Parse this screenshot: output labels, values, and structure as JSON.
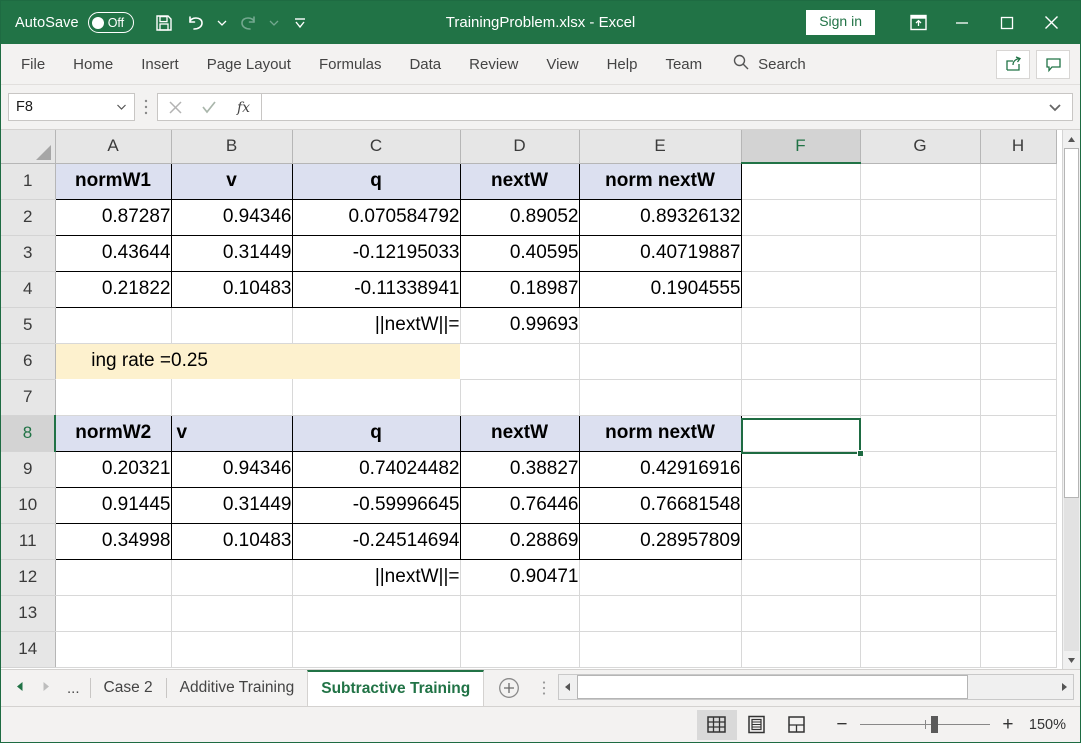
{
  "titlebar": {
    "autosave_label": "AutoSave",
    "autosave_state": "Off",
    "document_title": "TrainingProblem.xlsx  -  Excel",
    "sign_in": "Sign in",
    "icons": {
      "save": "save-icon",
      "undo": "undo-icon",
      "redo": "redo-icon",
      "customize": "customize-qat-icon",
      "ribbon_display": "ribbon-display-options-icon",
      "minimize": "minimize-icon",
      "maximize": "maximize-icon",
      "close": "close-icon"
    }
  },
  "ribbon": {
    "tabs": [
      {
        "label": "File"
      },
      {
        "label": "Home"
      },
      {
        "label": "Insert"
      },
      {
        "label": "Page Layout"
      },
      {
        "label": "Formulas"
      },
      {
        "label": "Data"
      },
      {
        "label": "Review"
      },
      {
        "label": "View"
      },
      {
        "label": "Help"
      },
      {
        "label": "Team"
      }
    ],
    "search_placeholder": "Search",
    "share_label": "Share",
    "comments_label": "Comments"
  },
  "formula_bar": {
    "name_box_value": "F8",
    "formula_value": "",
    "cancel_label": "Cancel",
    "enter_label": "Enter",
    "fx_label": "fx"
  },
  "grid": {
    "columns": [
      "A",
      "B",
      "C",
      "D",
      "E",
      "F",
      "G",
      "H"
    ],
    "active_column": "F",
    "active_row": 8,
    "selected_cell": "F8",
    "rows": [
      {
        "number": 1,
        "cells": [
          {
            "col": "A",
            "value": "normW1",
            "style": "hdr"
          },
          {
            "col": "B",
            "value": "v",
            "style": "hdr"
          },
          {
            "col": "C",
            "value": "q",
            "style": "hdr"
          },
          {
            "col": "D",
            "value": "nextW",
            "style": "hdr"
          },
          {
            "col": "E",
            "value": "norm nextW",
            "style": "hdr"
          },
          {
            "col": "F",
            "value": "",
            "style": "blank"
          },
          {
            "col": "G",
            "value": "",
            "style": "blank"
          },
          {
            "col": "H",
            "value": "",
            "style": "blank"
          }
        ]
      },
      {
        "number": 2,
        "cells": [
          {
            "col": "A",
            "value": "0.87287",
            "style": "blk-num"
          },
          {
            "col": "B",
            "value": "0.94346",
            "style": "blk-num"
          },
          {
            "col": "C",
            "value": "0.070584792",
            "style": "blk-num"
          },
          {
            "col": "D",
            "value": "0.89052",
            "style": "blk-num"
          },
          {
            "col": "E",
            "value": "0.89326132",
            "style": "blk-num"
          },
          {
            "col": "F",
            "value": "",
            "style": "blank"
          },
          {
            "col": "G",
            "value": "",
            "style": "blank"
          },
          {
            "col": "H",
            "value": "",
            "style": "blank"
          }
        ]
      },
      {
        "number": 3,
        "cells": [
          {
            "col": "A",
            "value": "0.43644",
            "style": "blk-num"
          },
          {
            "col": "B",
            "value": "0.31449",
            "style": "blk-num"
          },
          {
            "col": "C",
            "value": "-0.12195033",
            "style": "blk-num"
          },
          {
            "col": "D",
            "value": "0.40595",
            "style": "blk-num"
          },
          {
            "col": "E",
            "value": "0.40719887",
            "style": "blk-num"
          },
          {
            "col": "F",
            "value": "",
            "style": "blank"
          },
          {
            "col": "G",
            "value": "",
            "style": "blank"
          },
          {
            "col": "H",
            "value": "",
            "style": "blank"
          }
        ]
      },
      {
        "number": 4,
        "cells": [
          {
            "col": "A",
            "value": "0.21822",
            "style": "blk-num"
          },
          {
            "col": "B",
            "value": "0.10483",
            "style": "blk-num"
          },
          {
            "col": "C",
            "value": "-0.11338941",
            "style": "blk-num"
          },
          {
            "col": "D",
            "value": "0.18987",
            "style": "blk-num"
          },
          {
            "col": "E",
            "value": "0.1904555",
            "style": "blk-num"
          },
          {
            "col": "F",
            "value": "",
            "style": "blank"
          },
          {
            "col": "G",
            "value": "",
            "style": "blank"
          },
          {
            "col": "H",
            "value": "",
            "style": "blank"
          }
        ]
      },
      {
        "number": 5,
        "cells": [
          {
            "col": "A",
            "value": "",
            "style": "blank"
          },
          {
            "col": "B",
            "value": "",
            "style": "blank"
          },
          {
            "col": "C",
            "value": "||nextW||=",
            "style": "num"
          },
          {
            "col": "D",
            "value": "0.99693",
            "style": "num"
          },
          {
            "col": "E",
            "value": "",
            "style": "blank"
          },
          {
            "col": "F",
            "value": "",
            "style": "blank"
          },
          {
            "col": "G",
            "value": "",
            "style": "blank"
          },
          {
            "col": "H",
            "value": "",
            "style": "blank"
          }
        ]
      },
      {
        "number": 6,
        "cells": [
          {
            "col": "A",
            "value": "ing rate =",
            "style": "orange-num"
          },
          {
            "col": "B",
            "value": "0.25",
            "style": "orange-left"
          },
          {
            "col": "C",
            "value": "",
            "style": "orange-blank"
          },
          {
            "col": "D",
            "value": "",
            "style": "blank"
          },
          {
            "col": "E",
            "value": "",
            "style": "blank"
          },
          {
            "col": "F",
            "value": "",
            "style": "blank"
          },
          {
            "col": "G",
            "value": "",
            "style": "blank"
          },
          {
            "col": "H",
            "value": "",
            "style": "blank"
          }
        ]
      },
      {
        "number": 7,
        "cells": [
          {
            "col": "A",
            "value": "",
            "style": "blank"
          },
          {
            "col": "B",
            "value": "",
            "style": "blank"
          },
          {
            "col": "C",
            "value": "",
            "style": "blank"
          },
          {
            "col": "D",
            "value": "",
            "style": "blank"
          },
          {
            "col": "E",
            "value": "",
            "style": "blank"
          },
          {
            "col": "F",
            "value": "",
            "style": "blank"
          },
          {
            "col": "G",
            "value": "",
            "style": "blank"
          },
          {
            "col": "H",
            "value": "",
            "style": "blank"
          }
        ]
      },
      {
        "number": 8,
        "cells": [
          {
            "col": "A",
            "value": "normW2",
            "style": "hdr"
          },
          {
            "col": "B",
            "value": "v",
            "style": "hdr-left"
          },
          {
            "col": "C",
            "value": "q",
            "style": "hdr"
          },
          {
            "col": "D",
            "value": "nextW",
            "style": "hdr"
          },
          {
            "col": "E",
            "value": "norm nextW",
            "style": "hdr"
          },
          {
            "col": "F",
            "value": "",
            "style": "blank"
          },
          {
            "col": "G",
            "value": "",
            "style": "blank"
          },
          {
            "col": "H",
            "value": "",
            "style": "blank"
          }
        ]
      },
      {
        "number": 9,
        "cells": [
          {
            "col": "A",
            "value": "0.20321",
            "style": "blk-num"
          },
          {
            "col": "B",
            "value": "0.94346",
            "style": "blk-num"
          },
          {
            "col": "C",
            "value": "0.74024482",
            "style": "blk-num"
          },
          {
            "col": "D",
            "value": "0.38827",
            "style": "blk-num"
          },
          {
            "col": "E",
            "value": "0.42916916",
            "style": "blk-num"
          },
          {
            "col": "F",
            "value": "",
            "style": "blank"
          },
          {
            "col": "G",
            "value": "",
            "style": "blank"
          },
          {
            "col": "H",
            "value": "",
            "style": "blank"
          }
        ]
      },
      {
        "number": 10,
        "cells": [
          {
            "col": "A",
            "value": "0.91445",
            "style": "blk-num"
          },
          {
            "col": "B",
            "value": "0.31449",
            "style": "blk-num"
          },
          {
            "col": "C",
            "value": "-0.59996645",
            "style": "blk-num"
          },
          {
            "col": "D",
            "value": "0.76446",
            "style": "blk-num"
          },
          {
            "col": "E",
            "value": "0.76681548",
            "style": "blk-num"
          },
          {
            "col": "F",
            "value": "",
            "style": "blank"
          },
          {
            "col": "G",
            "value": "",
            "style": "blank"
          },
          {
            "col": "H",
            "value": "",
            "style": "blank"
          }
        ]
      },
      {
        "number": 11,
        "cells": [
          {
            "col": "A",
            "value": "0.34998",
            "style": "blk-num"
          },
          {
            "col": "B",
            "value": "0.10483",
            "style": "blk-num"
          },
          {
            "col": "C",
            "value": "-0.24514694",
            "style": "blk-num"
          },
          {
            "col": "D",
            "value": "0.28869",
            "style": "blk-num"
          },
          {
            "col": "E",
            "value": "0.28957809",
            "style": "blk-num"
          },
          {
            "col": "F",
            "value": "",
            "style": "blank"
          },
          {
            "col": "G",
            "value": "",
            "style": "blank"
          },
          {
            "col": "H",
            "value": "",
            "style": "blank"
          }
        ]
      },
      {
        "number": 12,
        "cells": [
          {
            "col": "A",
            "value": "",
            "style": "blank"
          },
          {
            "col": "B",
            "value": "",
            "style": "blank"
          },
          {
            "col": "C",
            "value": "||nextW||=",
            "style": "num"
          },
          {
            "col": "D",
            "value": "0.90471",
            "style": "num"
          },
          {
            "col": "E",
            "value": "",
            "style": "blank"
          },
          {
            "col": "F",
            "value": "",
            "style": "blank"
          },
          {
            "col": "G",
            "value": "",
            "style": "blank"
          },
          {
            "col": "H",
            "value": "",
            "style": "blank"
          }
        ]
      },
      {
        "number": 13,
        "cells": [
          {
            "col": "A",
            "value": "",
            "style": "blank"
          },
          {
            "col": "B",
            "value": "",
            "style": "blank"
          },
          {
            "col": "C",
            "value": "",
            "style": "blank"
          },
          {
            "col": "D",
            "value": "",
            "style": "blank"
          },
          {
            "col": "E",
            "value": "",
            "style": "blank"
          },
          {
            "col": "F",
            "value": "",
            "style": "blank"
          },
          {
            "col": "G",
            "value": "",
            "style": "blank"
          },
          {
            "col": "H",
            "value": "",
            "style": "blank"
          }
        ]
      },
      {
        "number": 14,
        "cells": [
          {
            "col": "A",
            "value": "",
            "style": "blank"
          },
          {
            "col": "B",
            "value": "",
            "style": "blank"
          },
          {
            "col": "C",
            "value": "",
            "style": "blank"
          },
          {
            "col": "D",
            "value": "",
            "style": "blank"
          },
          {
            "col": "E",
            "value": "",
            "style": "blank"
          },
          {
            "col": "F",
            "value": "",
            "style": "blank"
          },
          {
            "col": "G",
            "value": "",
            "style": "blank"
          },
          {
            "col": "H",
            "value": "",
            "style": "blank"
          }
        ]
      }
    ]
  },
  "sheet_tabs": {
    "ellipsis": "...",
    "tabs": [
      {
        "label": "Case 2",
        "active": false
      },
      {
        "label": "Additive Training",
        "active": false
      },
      {
        "label": "Subtractive Training",
        "active": true
      }
    ],
    "add_sheet_label": "New sheet"
  },
  "status_bar": {
    "views": [
      {
        "name": "normal-view",
        "active": true
      },
      {
        "name": "page-layout-view",
        "active": false
      },
      {
        "name": "page-break-preview",
        "active": false
      }
    ],
    "zoom_out_label": "−",
    "zoom_in_label": "+",
    "zoom_level": "150%"
  },
  "colors": {
    "excel_green": "#217346",
    "header_fill": "#dce0f0",
    "highlight_fill": "#fdf1ce",
    "selection_border": "#1e6b42"
  }
}
